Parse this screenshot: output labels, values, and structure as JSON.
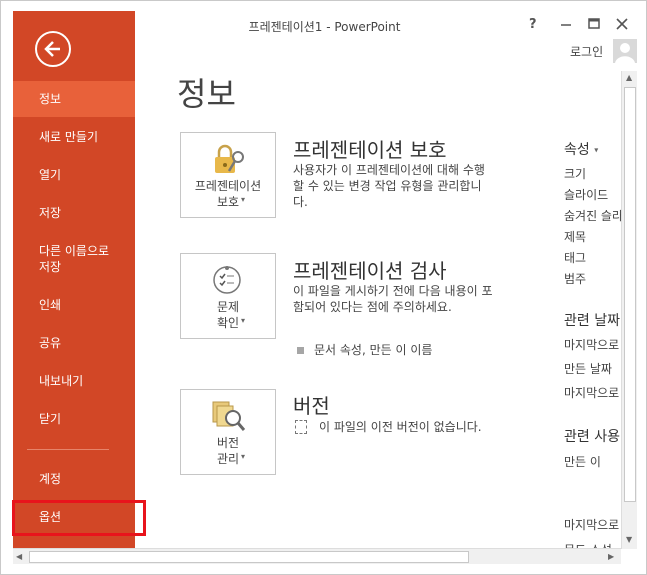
{
  "window": {
    "title": "프레젠테이션1 - PowerPoint",
    "help": "?",
    "login": "로그인"
  },
  "sidebar": {
    "items": [
      {
        "label": "정보"
      },
      {
        "label": "새로 만들기"
      },
      {
        "label": "열기"
      },
      {
        "label": "저장"
      },
      {
        "label": "다른 이름으로\n저장"
      },
      {
        "label": "인쇄"
      },
      {
        "label": "공유"
      },
      {
        "label": "내보내기"
      },
      {
        "label": "닫기"
      },
      {
        "label": "계정"
      },
      {
        "label": "옵션"
      }
    ]
  },
  "main": {
    "page_title": "정보",
    "sections": [
      {
        "button_label": "프레젠테이션\n보호",
        "title": "프레젠테이션 보호",
        "desc": "사용자가 이 프레젠테이션에 대해 수행할 수 있는 변경 작업 유형을 관리합니다."
      },
      {
        "button_label": "문제\n확인",
        "title": "프레젠테이션 검사",
        "desc": "이 파일을 게시하기 전에 다음 내용이 포함되어 있다는 점에 주의하세요.",
        "bullet": "문서 속성, 만든 이 이름"
      },
      {
        "button_label": "버전\n관리",
        "title": "버전",
        "desc": "이 파일의 이전 버전이 없습니다."
      }
    ]
  },
  "properties": {
    "heading": "속성",
    "items": [
      "크기",
      "슬라이드",
      "숨겨진 슬라",
      "제목",
      "태그",
      "범주"
    ],
    "related_dates_heading": "관련 날짜",
    "dates": [
      "마지막으로",
      "만든 날짜",
      "마지막으로"
    ],
    "related_people_heading": "관련 사용",
    "people": [
      "만든 이",
      "마지막으로",
      "문도 소석"
    ]
  },
  "colors": {
    "sidebar": "#d24726",
    "sidebar_active": "#e8613a",
    "highlight": "#e8141c"
  }
}
